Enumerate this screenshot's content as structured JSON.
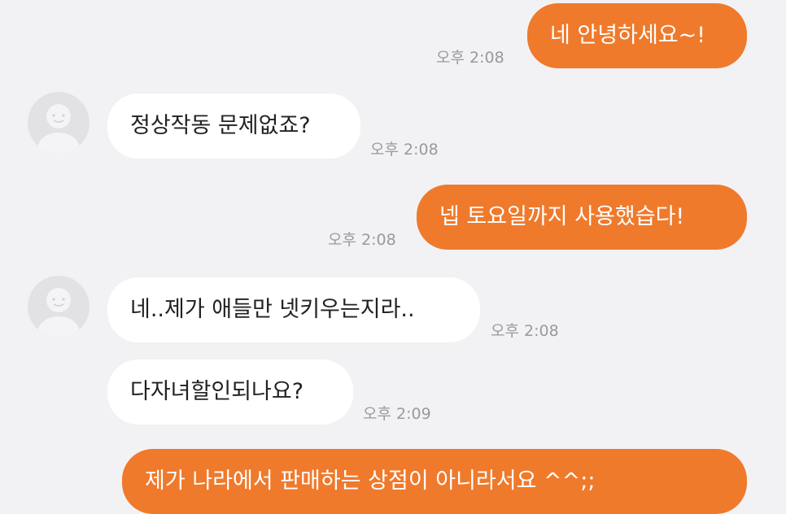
{
  "messages": [
    {
      "side": "out",
      "text": "네 안녕하세요~!",
      "time": "오후 2:08"
    },
    {
      "side": "in",
      "text": "정상작동 문제없죠?",
      "time": "오후 2:08",
      "avatar_icon": "default-profile-icon"
    },
    {
      "side": "out",
      "text": "넵 토요일까지 사용했습다!",
      "time": "오후 2:08"
    },
    {
      "side": "in",
      "text": "네..제가 애들만 넷키우는지라..",
      "time": "오후 2:08",
      "avatar_icon": "default-profile-icon"
    },
    {
      "side": "in",
      "text": "다자녀할인되나요?",
      "time": "오후 2:09"
    },
    {
      "side": "out",
      "text": "제가 나라에서 판매하는 상점이 아니라서요 ^^;;",
      "time": ""
    }
  ],
  "colors": {
    "background": "#f2f2f4",
    "outgoing_bubble": "#ef7a2c",
    "incoming_bubble": "#ffffff",
    "timestamp": "#9a9a9a"
  }
}
